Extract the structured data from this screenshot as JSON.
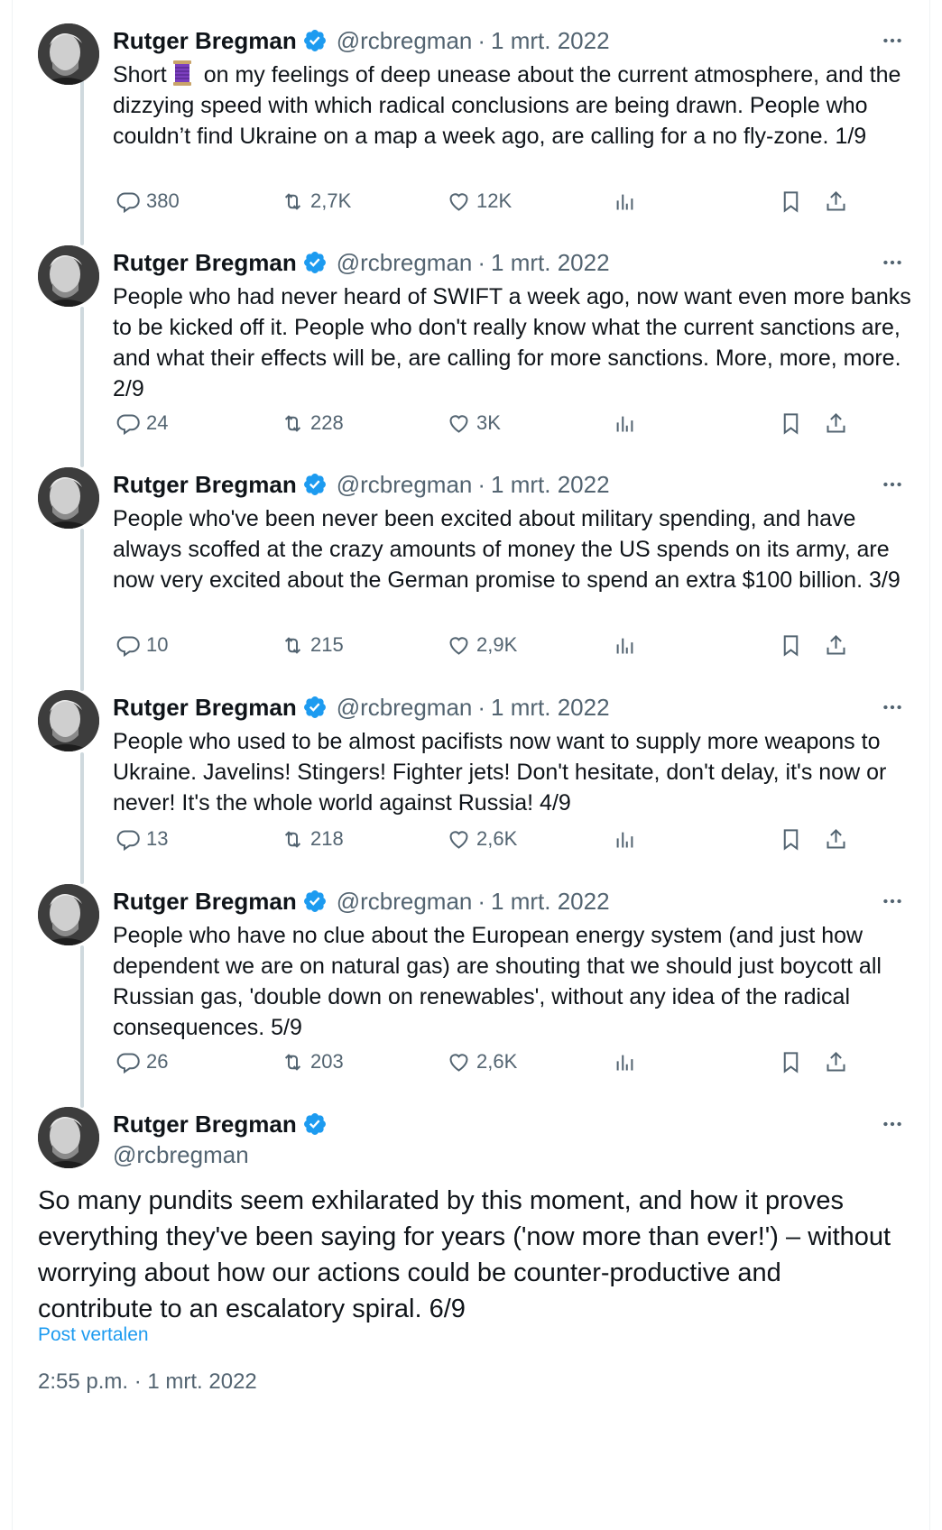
{
  "author": {
    "name": "Rutger Bregman",
    "handle": "@rcbregman"
  },
  "separator": "·",
  "colors": {
    "verified_badge": "#1d9bf0",
    "link": "#1d9bf0",
    "muted": "#536471",
    "thread_line": "#cfd9de"
  },
  "icons": {
    "more": "more-horizontal-icon",
    "reply": "reply-icon",
    "retweet": "retweet-icon",
    "like": "heart-icon",
    "views": "bar-chart-icon",
    "bookmark": "bookmark-icon",
    "share": "share-icon",
    "emoji": "thread-spool-emoji"
  },
  "tweets": [
    {
      "date": "1 mrt. 2022",
      "text_before_emoji": "Short",
      "text": "on my feelings of deep unease about the current atmosphere, and the dizzying speed with which radical conclusions are being drawn. People who couldn’t find Ukraine on a map a week ago, are calling for a no fly-zone. 1/9",
      "replies": "380",
      "retweets": "2,7K",
      "likes": "12K"
    },
    {
      "date": "1 mrt. 2022",
      "text": "People who had never heard of SWIFT a week ago, now want even more banks to be kicked off it. People who don't really know what the current sanctions are, and what their effects will be, are calling for more sanctions. More, more, more. 2/9",
      "replies": "24",
      "retweets": "228",
      "likes": "3K"
    },
    {
      "date": "1 mrt. 2022",
      "text": "People who've been never been excited about military spending, and have always scoffed at the crazy amounts of money the US spends on its army, are now very excited about the German promise to spend an extra $100 billion. 3/9",
      "replies": "10",
      "retweets": "215",
      "likes": "2,9K"
    },
    {
      "date": "1 mrt. 2022",
      "text": "People who used to be almost pacifists now want to  supply more weapons to Ukraine. Javelins! Stingers! Fighter jets! Don't hesitate, don't delay, it's now or never! It's the whole world against Russia! 4/9",
      "replies": "13",
      "retweets": "218",
      "likes": "2,6K"
    },
    {
      "date": "1 mrt. 2022",
      "text": "People who have no clue about the European energy system (and just how dependent we are on natural gas) are shouting that we should just boycott all Russian gas, 'double down on renewables', without any idea of the radical consequences. 5/9",
      "replies": "26",
      "retweets": "203",
      "likes": "2,6K"
    }
  ],
  "main_tweet": {
    "text": "So many pundits seem exhilarated by this moment, and how it proves everything they've been saying for years ('now more than ever!') – without worrying about how our actions could be counter-productive and contribute to an escalatory spiral. 6/9",
    "translate_label": "Post vertalen",
    "timestamp": "2:55 p.m. · 1 mrt. 2022"
  }
}
